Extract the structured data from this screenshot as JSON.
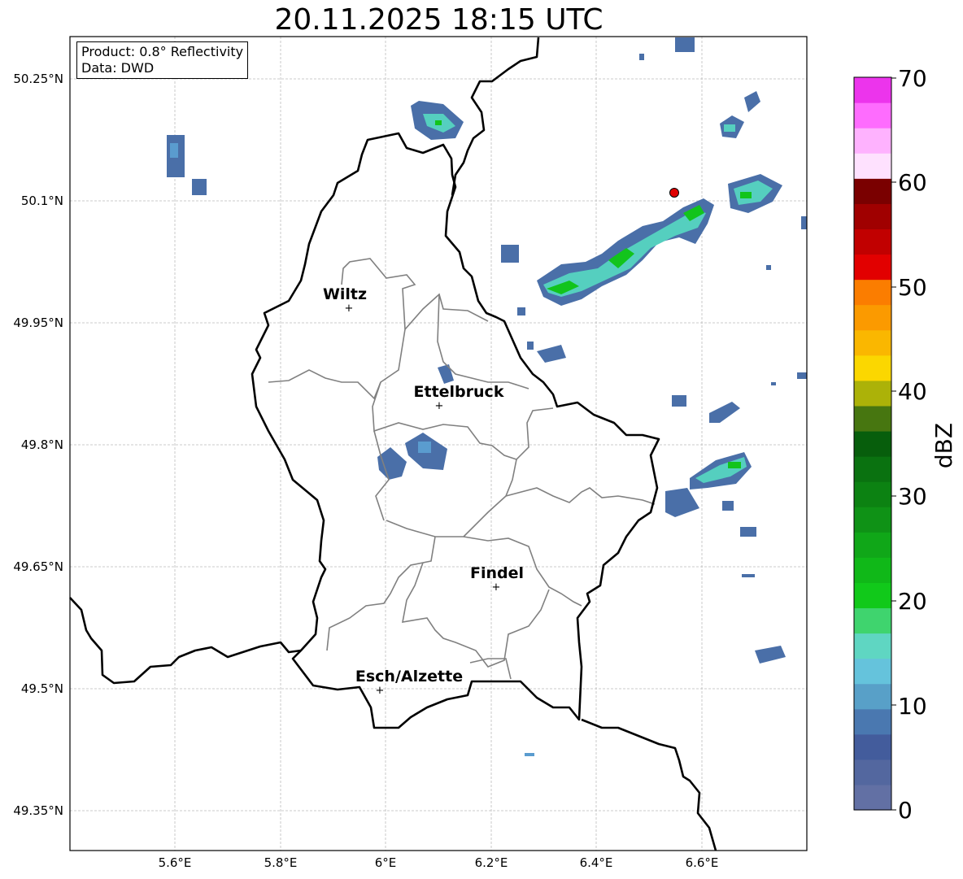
{
  "title": "20.11.2025 18:15 UTC",
  "info": {
    "product": "Product: 0.8° Reflectivity",
    "data": "Data: DWD"
  },
  "map": {
    "lon_range": [
      5.4,
      6.8
    ],
    "lat_range": [
      49.3,
      50.3
    ],
    "lat_ticks": [
      {
        "value": 50.25,
        "label": "50.25°N"
      },
      {
        "value": 50.1,
        "label": "50.1°N"
      },
      {
        "value": 49.95,
        "label": "49.95°N"
      },
      {
        "value": 49.8,
        "label": "49.8°N"
      },
      {
        "value": 49.65,
        "label": "49.65°N"
      },
      {
        "value": 49.5,
        "label": "49.5°N"
      },
      {
        "value": 49.35,
        "label": "49.35°N"
      }
    ],
    "lon_ticks": [
      {
        "value": 5.6,
        "label": "5.6°E"
      },
      {
        "value": 5.8,
        "label": "5.8°E"
      },
      {
        "value": 6.0,
        "label": "6°E"
      },
      {
        "value": 6.2,
        "label": "6.2°E"
      },
      {
        "value": 6.4,
        "label": "6.4°E"
      },
      {
        "value": 6.6,
        "label": "6.6°E"
      }
    ],
    "cities": [
      {
        "name": "Wiltz",
        "lon": 5.93,
        "lat": 49.967
      },
      {
        "name": "Ettelbruck",
        "lon": 6.103,
        "lat": 49.848
      },
      {
        "name": "Findel",
        "lon": 6.21,
        "lat": 49.626
      },
      {
        "name": "Esch/Alzette",
        "lon": 5.99,
        "lat": 49.499
      }
    ],
    "radar_site": {
      "lon": 6.548,
      "lat": 50.11,
      "color": "#e00000"
    }
  },
  "colorbar": {
    "label": "dBZ",
    "min": 0,
    "max": 70,
    "ticks": [
      "0",
      "10",
      "20",
      "30",
      "40",
      "50",
      "60",
      "70"
    ],
    "colors": [
      "#6270a4",
      "#53679f",
      "#435c9c",
      "#4a78b0",
      "#58a0c8",
      "#65c3dc",
      "#5fd6c2",
      "#3fd46e",
      "#11c91a",
      "#10b818",
      "#10a718",
      "#0f9216",
      "#0c8212",
      "#0a7210",
      "#075e0c",
      "#477610",
      "#acb208",
      "#fbd700",
      "#fab700",
      "#fb9a00",
      "#fb7d00",
      "#e20000",
      "#c10000",
      "#a00000",
      "#7a0000",
      "#fee1fe",
      "#feb2fe",
      "#fe6cfe",
      "#ec34ec"
    ]
  },
  "echo_colors": {
    "weak": "#4a6fa8",
    "light": "#5a9ccf",
    "medium": "#55cfbf",
    "strong": "#12c41c"
  }
}
